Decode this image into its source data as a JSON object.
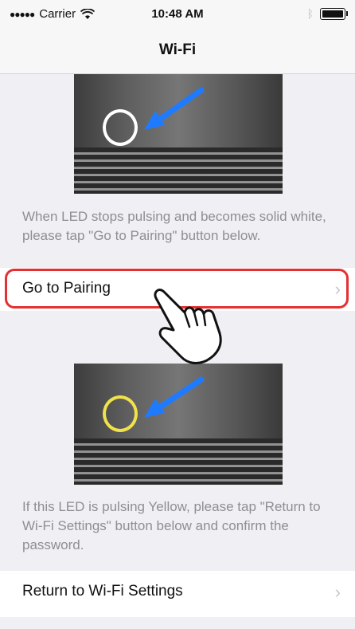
{
  "status_bar": {
    "signal_dots": "●●●●●",
    "carrier": "Carrier",
    "time": "10:48 AM",
    "wifi_icon": "wifi-icon",
    "bluetooth_icon": "bluetooth-icon",
    "battery_icon": "battery-icon"
  },
  "nav": {
    "title": "Wi-Fi"
  },
  "colors": {
    "background": "#efeff4",
    "highlight": "#e53032",
    "arrow": "#1e7bff",
    "led_white": "#ffffff",
    "led_yellow": "#f0e24a"
  },
  "section1": {
    "instruction": "When LED stops pulsing and becomes solid white, please tap \"Go to Pairing\" button below.",
    "button_label": "Go to Pairing"
  },
  "section2": {
    "instruction": "If this LED is pulsing Yellow, please tap \"Return to Wi-Fi Settings\" button below and confirm the password.",
    "button_label": "Return to Wi-Fi Settings"
  },
  "chevron": "›"
}
